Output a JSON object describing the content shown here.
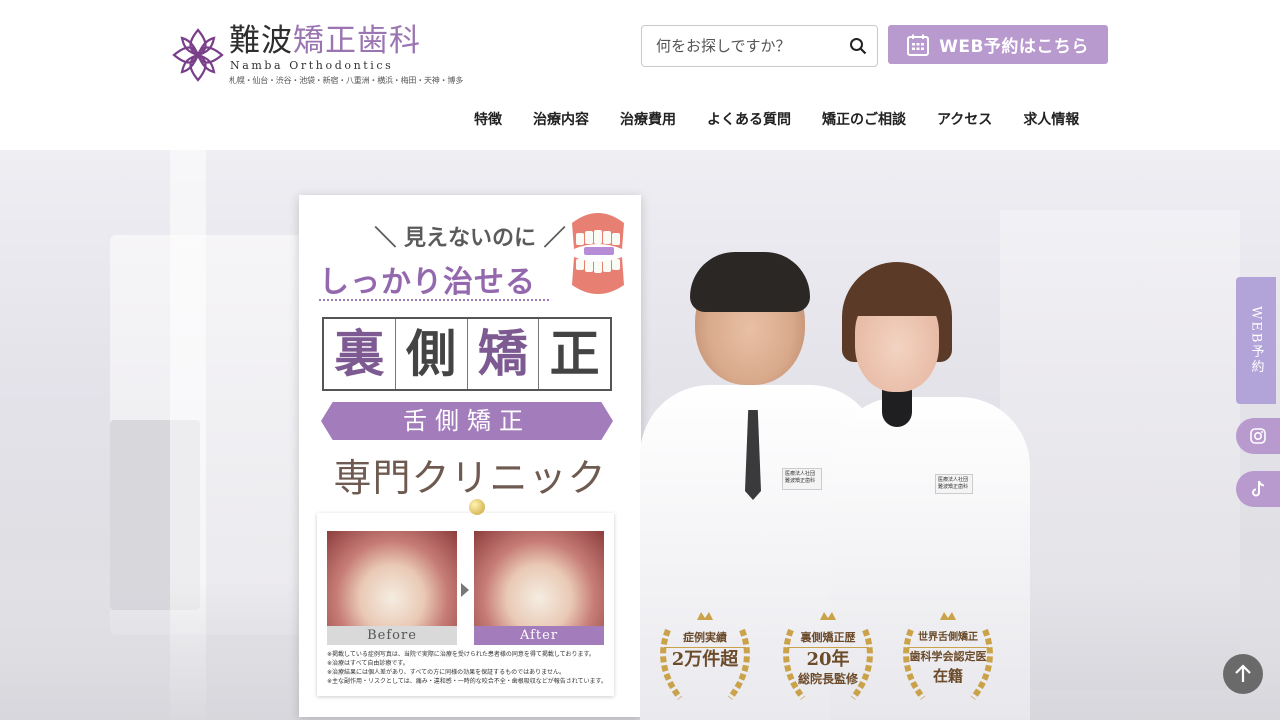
{
  "header": {
    "logo": {
      "title_a": "難波",
      "title_b": "矯正歯科",
      "title_en": "Namba Orthodontics",
      "branches": "札幌・仙台・渋谷・池袋・新宿・八重洲・横浜・梅田・天神・博多"
    },
    "search": {
      "placeholder": "何をお探しですか？",
      "icon": "search-icon"
    },
    "web_reservation": {
      "label": "WEB予約はこちら",
      "icon": "calendar-icon"
    },
    "nav": [
      "特徴",
      "治療内容",
      "治療費用",
      "よくある質問",
      "矯正のご相談",
      "アクセス",
      "求人情報"
    ]
  },
  "hero": {
    "card": {
      "tagline": "見えないのに",
      "headline": "しっかり治せる",
      "big_chars": [
        "裏",
        "側",
        "矯",
        "正"
      ],
      "ribbon": "舌側矯正",
      "specialty": "専門クリニック",
      "before_label": "Before",
      "after_label": "After",
      "notes": [
        "※掲載している症例写真は、当院で実際に治療を受けられた患者様の同意を得て掲載しております。",
        "※治療はすべて自由診療です。",
        "※治療結果には個人差があり、すべての方に同様の効果を保証するものではありません。",
        "※主な副作用・リスクとしては、痛み・違和感・一時的な咬合不全・歯根吸収などが報告されています。"
      ]
    },
    "doctor_badge": "医療法人社団 難波矯正歯科",
    "nurse_badge": "医療法人社団 難波矯正歯科",
    "awards": [
      {
        "line1": "症例実績",
        "line2": "2万件超",
        "line3": ""
      },
      {
        "line1": "裏側矯正歴",
        "line2": "20年",
        "line3": "総院長監修"
      },
      {
        "line1": "世界舌側矯正",
        "line2": "歯科学会認定医",
        "line3": "在籍"
      }
    ]
  },
  "side": {
    "web_label": "WEB予約",
    "instagram_icon": "instagram-icon",
    "tiktok_icon": "tiktok-icon",
    "to_top_icon": "arrow-up-icon"
  },
  "colors": {
    "accent": "#b99acf",
    "accent_dark": "#9468ad",
    "side_web": "#b2a4d8"
  }
}
